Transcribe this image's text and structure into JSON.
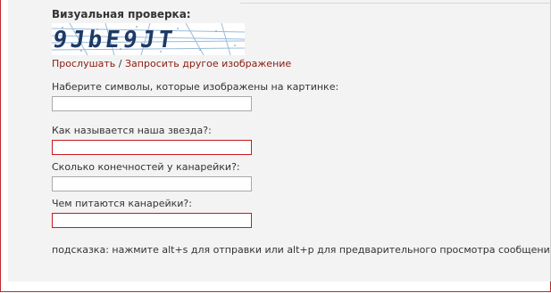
{
  "captcha": {
    "title": "Визуальная проверка:",
    "image_text": "9JbE9JT",
    "listen_link": "Прослушать",
    "separator": "/",
    "new_image_link": "Запросить другое изображение"
  },
  "fields": [
    {
      "label": "Наберите символы, которые изображены на картинке:",
      "value": "",
      "state": "normal"
    },
    {
      "label": "Как называется наша звезда?:",
      "value": "",
      "state": "error"
    },
    {
      "label": "Сколько конечностей у канарейки?:",
      "value": "",
      "state": "normal"
    },
    {
      "label": "Чем питаются канарейки?:",
      "value": "",
      "state": "error"
    }
  ],
  "hint": "подсказка: нажмите alt+s для отправки или alt+p для предварительного просмотра сообщения",
  "colors": {
    "frame_border": "#c0282d",
    "link": "#8b1a10",
    "error_border": "#c8191e",
    "panel_bg": "#f3f3f3"
  }
}
